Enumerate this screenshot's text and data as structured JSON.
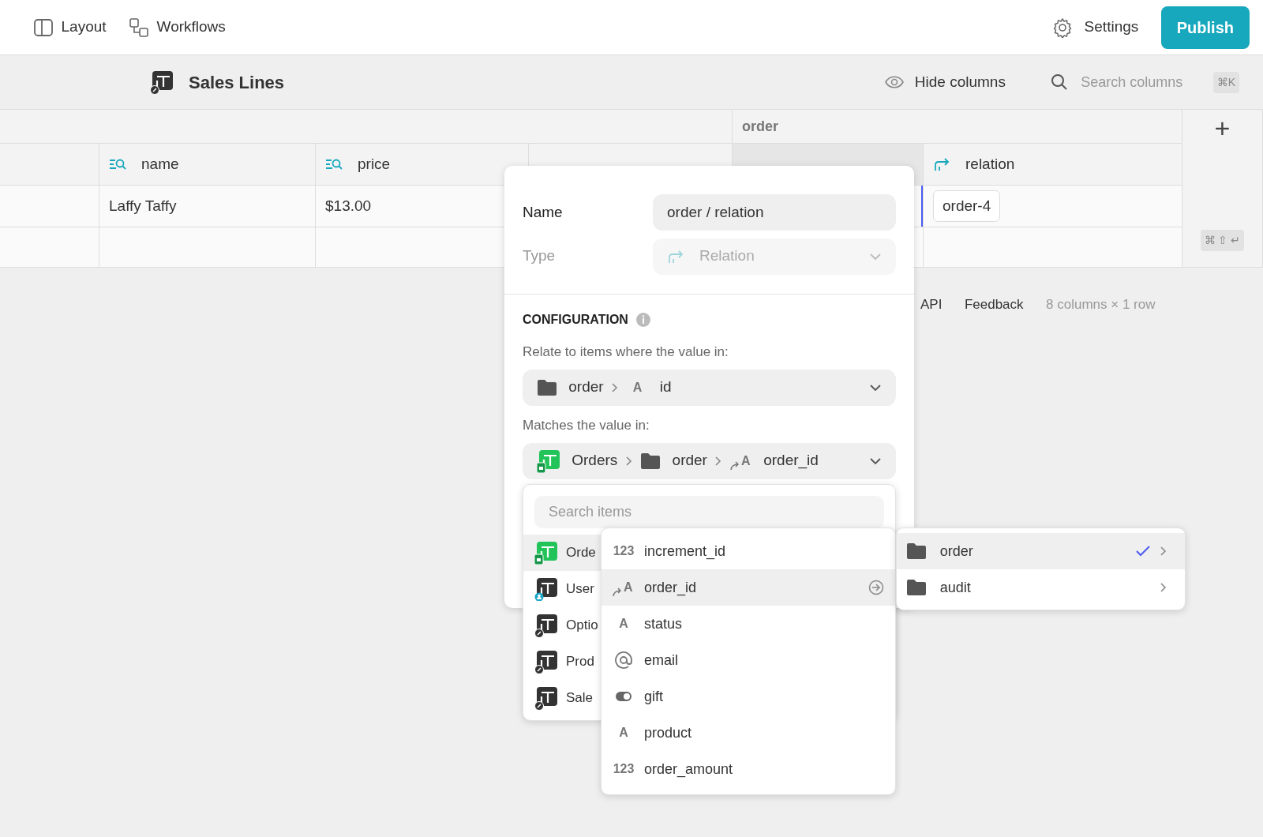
{
  "topbar": {
    "nav": [
      {
        "label": "Layout",
        "kind": "layout"
      },
      {
        "label": "Workflows",
        "kind": "workflow"
      }
    ],
    "settings": "Settings",
    "publish": "Publish"
  },
  "header": {
    "title": "Sales Lines",
    "hide_columns": "Hide columns",
    "search_placeholder": "Search columns",
    "shortcut": "⌘K"
  },
  "table": {
    "group_header": "order",
    "columns": [
      {
        "kind": "blank"
      },
      {
        "label": "name",
        "kind": "lookup"
      },
      {
        "label": "price",
        "kind": "lookup"
      },
      {
        "kind": "blank"
      },
      {
        "kind": "blank",
        "selected": true
      },
      {
        "label": "relation",
        "kind": "relation"
      }
    ],
    "rows": [
      {
        "name": "Laffy Taffy",
        "price": "$13.00",
        "relation": "order-4",
        "id_selected": true
      }
    ],
    "add_column": "+",
    "row_shortcut": "⌘ ⇧ ↵"
  },
  "footer": [
    "API",
    "Feedback",
    "8 columns × 1 row"
  ],
  "popover": {
    "name_label": "Name",
    "name_value": "order / relation",
    "type_label": "Type",
    "type_value": "Relation",
    "type_disabled": true,
    "section": "CONFIGURATION",
    "relate_label": "Relate to items where the value in:",
    "relate_path": [
      {
        "label": "order",
        "kind": "folder"
      },
      {
        "label": "id",
        "glyph": "A"
      }
    ],
    "matches_label": "Matches the value in:",
    "matches_path": [
      {
        "label": "Orders",
        "kind": "sheet-green"
      },
      {
        "label": "order",
        "kind": "folder"
      },
      {
        "label": "order_id",
        "kind": "relation-text",
        "glyph": "A"
      }
    ]
  },
  "menu": {
    "search_placeholder": "Search items",
    "tables": [
      {
        "label": "Orde",
        "kind": "sheet-green",
        "selected": true
      },
      {
        "label": "User",
        "kind": "sheet-user",
        "selected": false
      },
      {
        "label": "Optio",
        "kind": "sheet",
        "selected": false
      },
      {
        "label": "Prod",
        "kind": "sheet",
        "selected": false
      },
      {
        "label": "Sale",
        "kind": "sheet",
        "selected": false
      }
    ],
    "fields": [
      {
        "label": "increment_id",
        "glyph": "123",
        "selected": false
      },
      {
        "label": "order_id",
        "kind": "relation-text",
        "glyph": "A",
        "selected": true
      },
      {
        "label": "status",
        "glyph": "A",
        "selected": false
      },
      {
        "label": "email",
        "kind": "email",
        "selected": false
      },
      {
        "label": "gift",
        "kind": "toggle",
        "selected": false
      },
      {
        "label": "product",
        "glyph": "A",
        "selected": false
      },
      {
        "label": "order_amount",
        "glyph": "123",
        "selected": false
      }
    ],
    "groups": [
      {
        "label": "order",
        "selected": true,
        "checked": true
      },
      {
        "label": "audit",
        "selected": false,
        "checked": false
      }
    ]
  }
}
